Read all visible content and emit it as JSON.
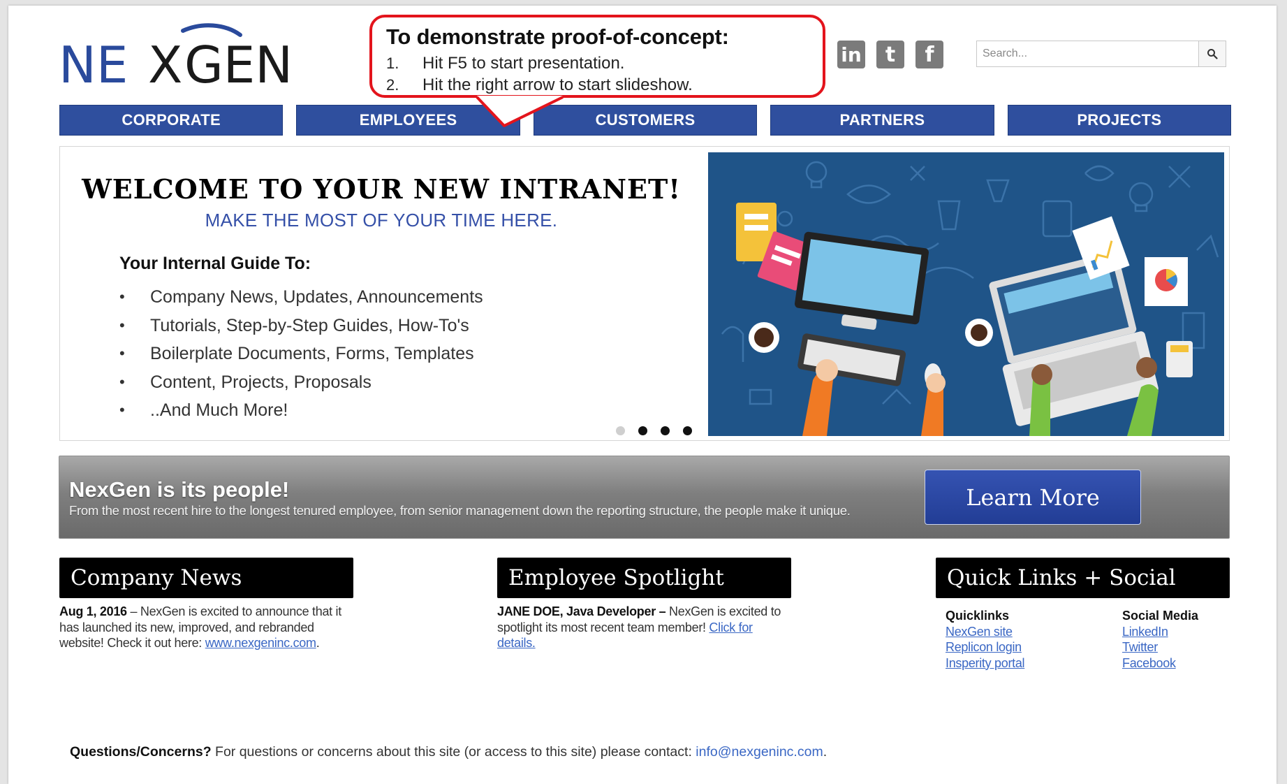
{
  "logo": {
    "text_left": "NE",
    "text_x": "X",
    "text_right": "GEN"
  },
  "callout": {
    "title": "To demonstrate proof-of-concept:",
    "steps": [
      {
        "num": "1.",
        "text": "Hit F5 to start presentation."
      },
      {
        "num": "2.",
        "text": "Hit the right arrow to start slideshow."
      }
    ]
  },
  "social_icons": [
    {
      "name": "linkedin-icon",
      "glyph": "in"
    },
    {
      "name": "twitter-icon",
      "glyph": "t"
    },
    {
      "name": "facebook-icon",
      "glyph": "f"
    }
  ],
  "search": {
    "placeholder": "Search...",
    "icon": "search-icon"
  },
  "nav": [
    "CORPORATE",
    "EMPLOYEES",
    "CUSTOMERS",
    "PARTNERS",
    "PROJECTS"
  ],
  "hero": {
    "title": "WELCOME TO YOUR NEW INTRANET!",
    "subtitle": "MAKE THE MOST OF YOUR TIME HERE.",
    "guide_heading": "Your Internal Guide To:",
    "bullet": "•",
    "items": [
      "Company News, Updates, Announcements",
      "Tutorials, Step-by-Step Guides, How-To's",
      "Boilerplate Documents, Forms, Templates",
      "Content, Projects, Proposals",
      "..And Much More!"
    ],
    "carousel_active_index": 0,
    "carousel_count": 4
  },
  "banner": {
    "title": "NexGen is its people!",
    "text": "From the most recent hire to the longest tenured employee, from senior management down the reporting structure, the people make it unique.",
    "button": "Learn More"
  },
  "news": {
    "heading": "Company News",
    "date": "Aug 1, 2016",
    "dash": " – ",
    "text": "NexGen is excited to announce that it has launched its new, improved, and rebranded website! Check it out here: ",
    "link": "www.nexgeninc.com",
    "end": "."
  },
  "spotlight": {
    "heading": "Employee Spotlight",
    "name": "JANE DOE, Java Developer –",
    "text": " NexGen is excited to spotlight its most recent team member! ",
    "link": "Click for details."
  },
  "quicklinks": {
    "heading": "Quick Links + Social",
    "col1_title": "Quicklinks",
    "col1_links": [
      "NexGen site",
      "Replicon login",
      "Insperity portal"
    ],
    "col2_title": "Social Media",
    "col2_links": [
      "LinkedIn",
      "Twitter",
      "Facebook"
    ]
  },
  "footer": {
    "label": "Questions/Concerns?",
    "text": " For questions or concerns about this site (or access to this site) please contact: ",
    "email": "info@nexgeninc.com",
    "end": "."
  },
  "colors": {
    "nav_blue": "#2f4f9e",
    "logo_blue": "#2a4a9c",
    "callout_red": "#e3141c",
    "link_blue": "#3a67c4",
    "hero_bg": "#1f5488"
  }
}
